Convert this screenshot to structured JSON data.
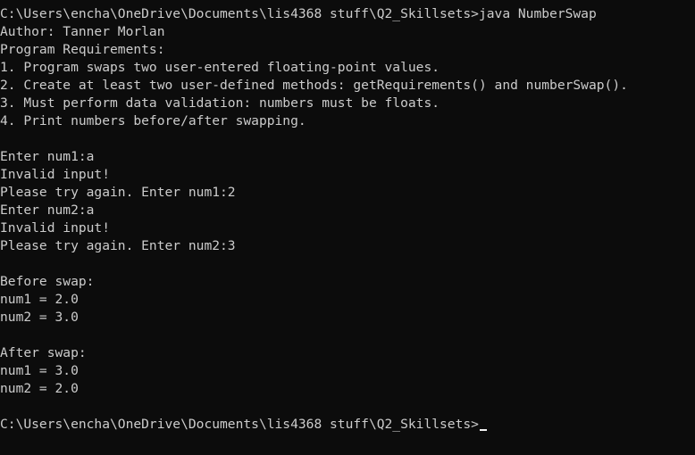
{
  "console": {
    "lines": [
      "C:\\Users\\encha\\OneDrive\\Documents\\lis4368 stuff\\Q2_Skillsets>java NumberSwap",
      "Author: Tanner Morlan",
      "Program Requirements:",
      "1. Program swaps two user-entered floating-point values.",
      "2. Create at least two user-defined methods: getRequirements() and numberSwap().",
      "3. Must perform data validation: numbers must be floats.",
      "4. Print numbers before/after swapping.",
      "",
      "Enter num1:a",
      "Invalid input!",
      "Please try again. Enter num1:2",
      "Enter num2:a",
      "Invalid input!",
      "Please try again. Enter num2:3",
      "",
      "Before swap:",
      "num1 = 2.0",
      "num2 = 3.0",
      "",
      "After swap:",
      "num1 = 3.0",
      "num2 = 2.0",
      "",
      "C:\\Users\\encha\\OneDrive\\Documents\\lis4368 stuff\\Q2_Skillsets>"
    ]
  },
  "colors": {
    "background": "#0c0c0c",
    "text": "#cccccc",
    "cursor": "#f2f2f2"
  }
}
